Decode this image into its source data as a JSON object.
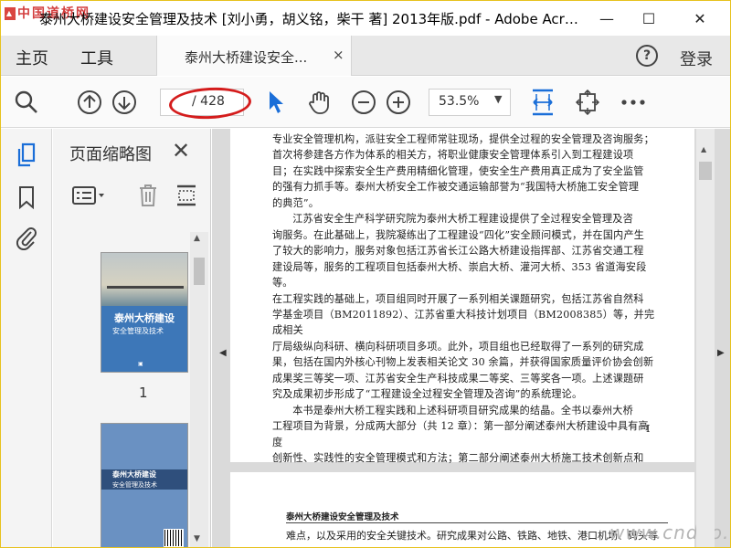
{
  "window": {
    "title": "泰州大桥建设安全管理及技术 [刘小勇，胡义铭，柴干 著] 2013年版.pdf - Adobe Acr…",
    "logo_text": "中国道桥网",
    "min_glyph": "—",
    "max_glyph": "☐",
    "close_glyph": "✕"
  },
  "menubar": {
    "home": "主页",
    "tools": "工具",
    "tab_label": "泰州大桥建设安全...",
    "tab_close": "×",
    "help": "?",
    "login": "登录"
  },
  "toolbar": {
    "page_current": "",
    "page_total": "/ 428",
    "zoom": "53.5%",
    "zoom_arrow": "▼"
  },
  "thumbnail_panel": {
    "title": "页面缩略图",
    "close": "✕",
    "page1_cover_title": "泰州大桥建设",
    "page1_cover_sub": "安全管理及技术",
    "page1_number": "1",
    "page2_cover_title": "泰州大桥建设",
    "page2_cover_sub": "安全管理及技术"
  },
  "document": {
    "lines": [
      "专业安全管理机构，派驻安全工程师常驻现场，提供全过程的安全管理及咨询服务；",
      "首次将参建各方作为体系的相关方，将职业健康安全管理体系引入到工程建设项",
      "目；在实践中探索安全生产费用精细化管理，使安全生产费用真正成为了安全监管",
      "的强有力抓手等。泰州大桥安全工作被交通运输部誉为“我国特大桥施工安全管理",
      "的典范”。",
      "江苏省安全生产科学研究院为泰州大桥工程建设提供了全过程安全管理及咨",
      "询服务。在此基础上，我院凝练出了工程建设“四化”安全顾问模式，并在国内产生",
      "了较大的影响力，服务对象包括江苏省长江公路大桥建设指挥部、江苏省交通工程",
      "建设局等，服务的工程项目包括泰州大桥、崇启大桥、灌河大桥、353 省道海安段等。",
      "在工程实践的基础上，项目组同时开展了一系列相关课题研究，包括江苏省自然科",
      "学基金项目（BM2011892）、江苏省重大科技计划项目（BM2008385）等，并完成相关",
      "厅局级纵向科研、横向科研项目多项。此外，项目组也已经取得了一系列的研究成",
      "果，包括在国内外核心刊物上发表相关论文 30 余篇，并获得国家质量评价协会创新",
      "成果奖三等奖一项、江苏省安全生产科技成果二等奖、三等奖各一项。上述课题研",
      "究及成果初步形成了“工程建设全过程安全管理及咨询”的系统理论。",
      "本书是泰州大桥工程实践和上述科研项目研究成果的结晶。全书以泰州大桥",
      "工程项目为背景，分成两大部分（共 12 章）：第一部分阐述泰州大桥建设中具有高度",
      "创新性、实践性的安全管理模式和方法；第二部分阐述泰州大桥施工技术创新点和"
    ],
    "page_footer": "I",
    "running_head": "泰州大桥建设安全管理及技术",
    "page2_line": "难点，以及采用的安全关键技术。研究成果对公路、铁路、地铁、港口机场、码头等",
    "watermark": "www.cndao.com"
  }
}
